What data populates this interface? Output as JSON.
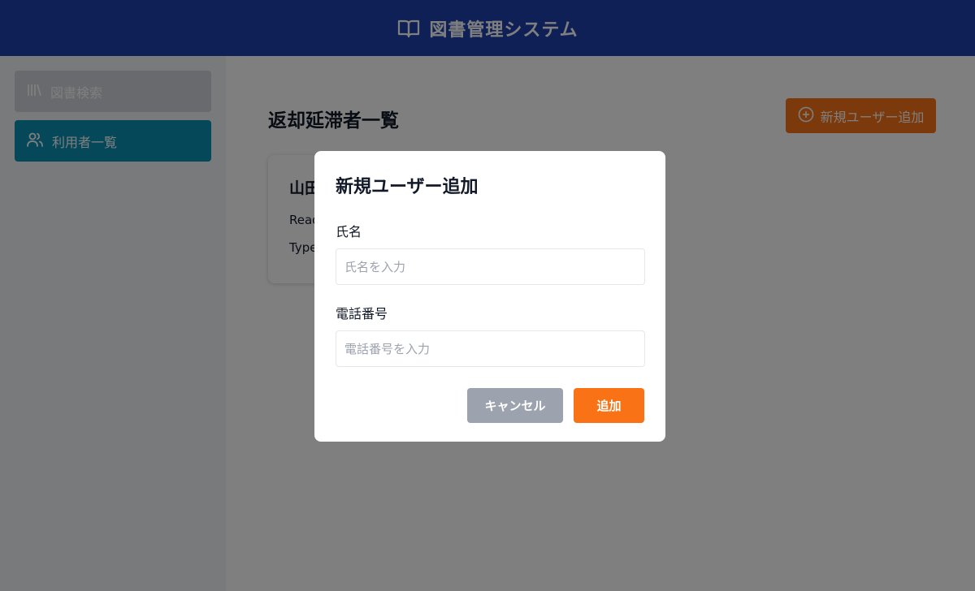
{
  "header": {
    "title": "図書管理システム",
    "icon": "book-open-icon"
  },
  "sidebar": {
    "items": [
      {
        "label": "図書検索",
        "icon": "library-icon",
        "active": false
      },
      {
        "label": "利用者一覧",
        "icon": "users-icon",
        "active": true
      }
    ]
  },
  "main": {
    "title": "返却延滞者一覧",
    "add_button_label": "新規ユーザー追加",
    "add_button_icon": "plus-circle-icon",
    "card": {
      "name": "山田",
      "line1": "Read",
      "line2": "Type"
    }
  },
  "modal": {
    "title": "新規ユーザー追加",
    "name_label": "氏名",
    "name_placeholder": "氏名を入力",
    "name_value": "",
    "phone_label": "電話番号",
    "phone_placeholder": "電話番号を入力",
    "phone_value": "",
    "cancel_label": "キャンセル",
    "submit_label": "追加"
  },
  "colors": {
    "header": "#1e40af",
    "active_nav": "#0891b2",
    "accent": "#f97316",
    "cancel": "#9ca3af"
  }
}
